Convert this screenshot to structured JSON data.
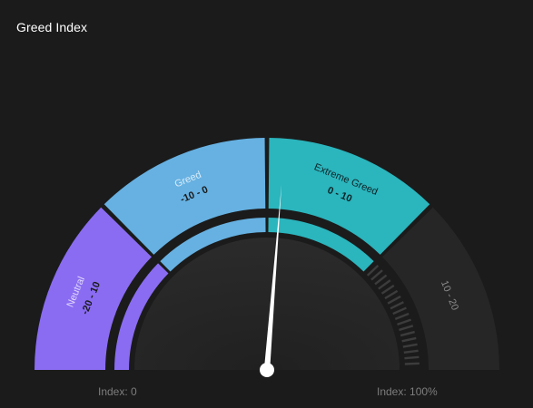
{
  "card": {
    "title": "Greed Index"
  },
  "chart_data": {
    "type": "gauge",
    "title": "Greed Index",
    "range": [
      -20,
      20
    ],
    "value": 1,
    "bands": [
      {
        "name": "Neutral",
        "label": "-20 - 10",
        "from": -20,
        "to": -10,
        "color": "#8a6cf2",
        "active": true
      },
      {
        "name": "Greed",
        "label": "-10 - 0",
        "from": -10,
        "to": 0,
        "color": "#66b1e2",
        "active": true
      },
      {
        "name": "Extreme Greed",
        "label": "0 - 10",
        "from": 0,
        "to": 10,
        "color": "#2bb5bd",
        "active": true
      },
      {
        "name": "",
        "label": "10 - 20",
        "from": 10,
        "to": 20,
        "color": "#262626",
        "active": false
      }
    ],
    "min_label": "Index: 0",
    "max_label": "Index: 100%"
  },
  "colors": {
    "background": "#1b1b1b",
    "dial_face": "#262626",
    "needle": "#ffffff",
    "inactive_band": "#262626",
    "tick": "#3c3c3c"
  }
}
